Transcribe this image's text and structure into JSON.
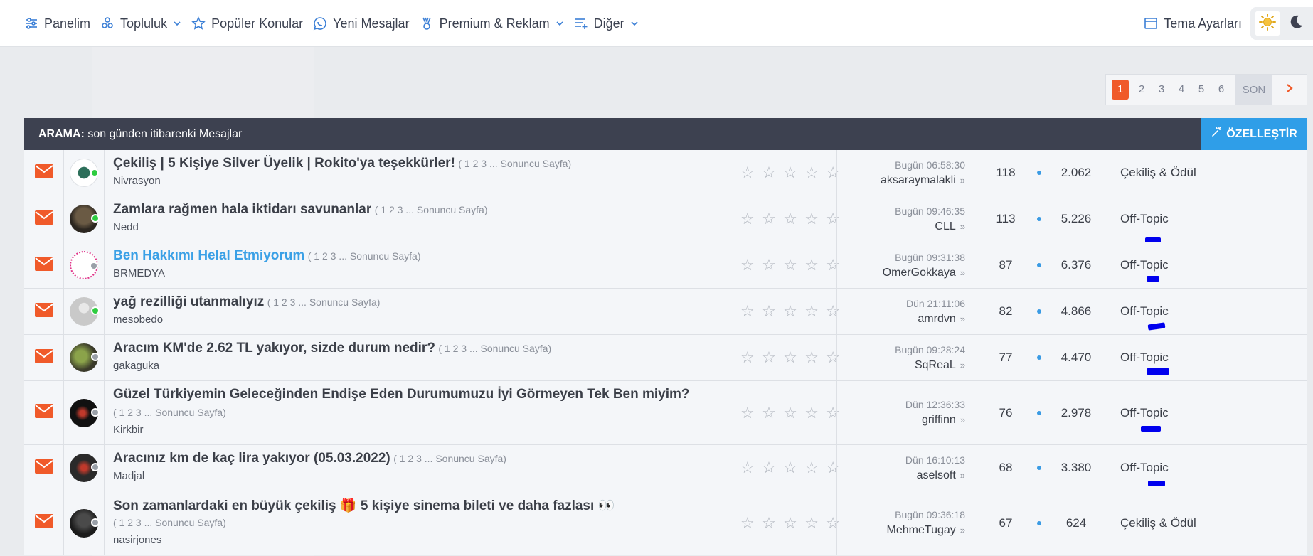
{
  "nav": {
    "items": [
      {
        "label": "Panelim",
        "icon": "sliders-icon",
        "dropdown": false
      },
      {
        "label": "Topluluk",
        "icon": "community-icon",
        "dropdown": true
      },
      {
        "label": "Popüler Konular",
        "icon": "star-icon",
        "dropdown": false
      },
      {
        "label": "Yeni Mesajlar",
        "icon": "chat-icon",
        "dropdown": false
      },
      {
        "label": "Premium & Reklam",
        "icon": "medal-icon",
        "dropdown": true
      },
      {
        "label": "Diğer",
        "icon": "list-plus-icon",
        "dropdown": true
      }
    ],
    "theme_settings": "Tema Ayarları"
  },
  "pagination": {
    "pages": [
      "1",
      "2",
      "3",
      "4",
      "5",
      "6"
    ],
    "active": "1",
    "last": "SON"
  },
  "list": {
    "header_prefix": "ARAMA:",
    "header_text": " son günden itibarenki Mesajlar",
    "customize_label": "ÖZELLEŞTİR"
  },
  "topics": [
    {
      "title": "Çekiliş | 5 Kişiye Silver Üyelik | Rokito'ya teşekkürler!",
      "pages": "( 1 2 3 ... Sonuncu Sayfa)",
      "author": "Nivrasyon",
      "last_date": "Bugün 06:58:30",
      "last_user": "aksaraymalakli",
      "replies": "118",
      "views": "2.062",
      "forum": "Çekiliş & Ödül",
      "online": true,
      "highlight": false
    },
    {
      "title": "Zamlara rağmen hala iktidarı savunanlar",
      "pages": "( 1 2 3 ... Sonuncu Sayfa)",
      "author": "Nedd",
      "last_date": "Bugün 09:46:35",
      "last_user": "CLL",
      "replies": "113",
      "views": "5.226",
      "forum": "Off-Topic",
      "online": true,
      "highlight": false
    },
    {
      "title": "Ben Hakkımı Helal Etmiyorum",
      "pages": "( 1 2 3 ... Sonuncu Sayfa)",
      "author": "BRMEDYA",
      "last_date": "Bugün 09:31:38",
      "last_user": "OmerGokkaya",
      "replies": "87",
      "views": "6.376",
      "forum": "Off-Topic",
      "online": false,
      "highlight": true
    },
    {
      "title": "yağ rezilliği utanmalıyız",
      "pages": "( 1 2 3 ... Sonuncu Sayfa)",
      "author": "mesobedo",
      "last_date": "Dün 21:11:06",
      "last_user": "amrdvn",
      "replies": "82",
      "views": "4.866",
      "forum": "Off-Topic",
      "online": true,
      "highlight": false
    },
    {
      "title": "Aracım KM'de 2.62 TL yakıyor, sizde durum nedir?",
      "pages": "( 1 2 3 ... Sonuncu Sayfa)",
      "author": "gakaguka",
      "last_date": "Bugün 09:28:24",
      "last_user": "SqReaL",
      "replies": "77",
      "views": "4.470",
      "forum": "Off-Topic",
      "online": false,
      "highlight": false
    },
    {
      "title": "Güzel Türkiyemin Geleceğinden Endişe Eden Durumumuzu İyi Görmeyen Tek Ben miyim?",
      "pages": "( 1 2 3 ... Sonuncu Sayfa)",
      "author": "Kirkbir",
      "last_date": "Dün 12:36:33",
      "last_user": "griffinn",
      "replies": "76",
      "views": "2.978",
      "forum": "Off-Topic",
      "online": false,
      "highlight": false
    },
    {
      "title": "Aracınız km de kaç lira yakıyor (05.03.2022)",
      "pages": "( 1 2 3 ... Sonuncu Sayfa)",
      "author": "Madjal",
      "last_date": "Dün 16:10:13",
      "last_user": "aselsoft",
      "replies": "68",
      "views": "3.380",
      "forum": "Off-Topic",
      "online": false,
      "highlight": false
    },
    {
      "title": "Son zamanlardaki en büyük çekiliş 🎁 5 kişiye sinema bileti ve daha fazlası 👀",
      "pages": "( 1 2 3 ... Sonuncu Sayfa)",
      "author": "nasirjones",
      "last_date": "Bugün 09:36:18",
      "last_user": "MehmeTugay",
      "replies": "67",
      "views": "624",
      "forum": "Çekiliş & Ödül",
      "online": false,
      "highlight": false
    }
  ],
  "colors": {
    "accent": "#f05a2a",
    "blue": "#2f9ee8",
    "header_bg": "#3d4150",
    "online": "#2ecc40",
    "offline": "#9aa0a8"
  }
}
